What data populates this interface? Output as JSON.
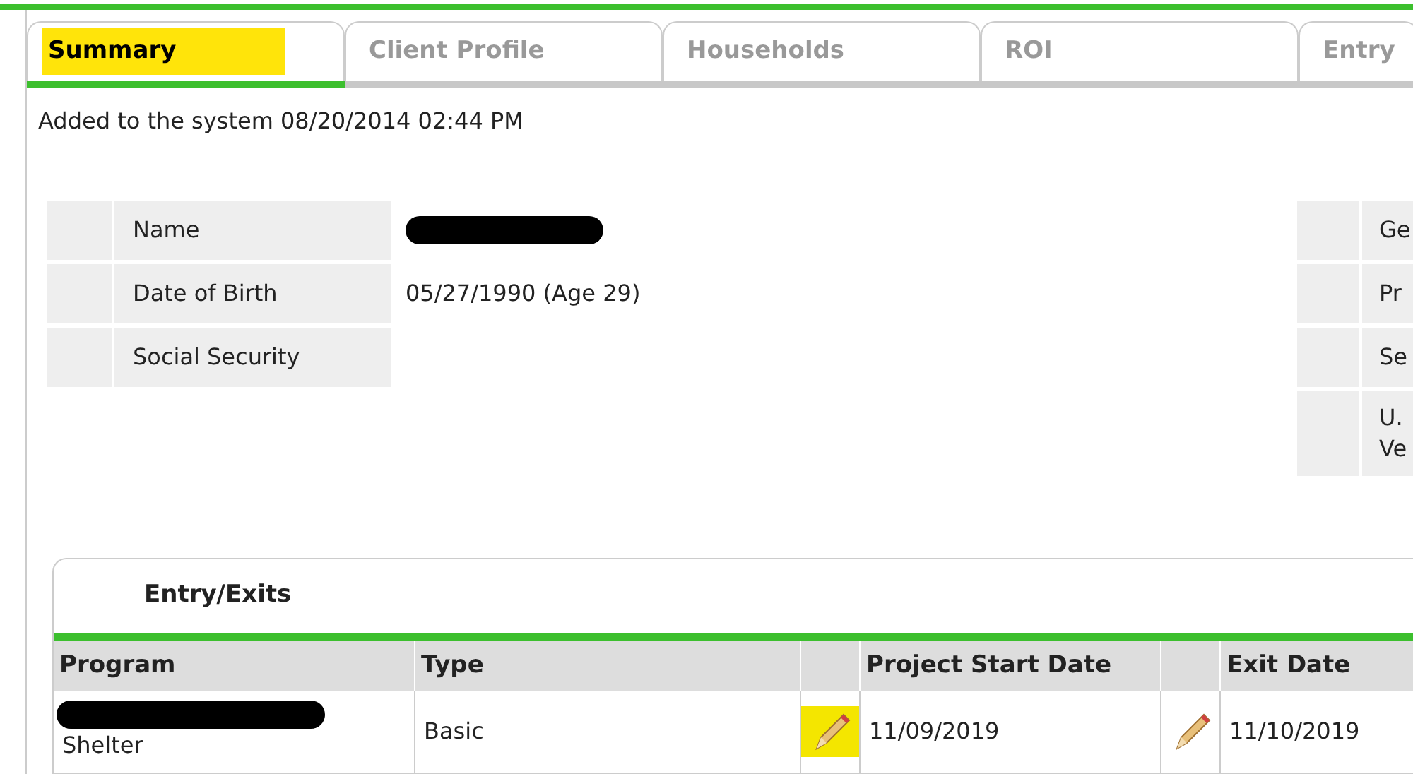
{
  "tabs": [
    {
      "label": "Summary",
      "selected": true
    },
    {
      "label": "Client Profile",
      "selected": false
    },
    {
      "label": "Households",
      "selected": false
    },
    {
      "label": "ROI",
      "selected": false
    },
    {
      "label": "Entry",
      "selected": false
    }
  ],
  "added_note": "Added to the system 08/20/2014 02:44 PM",
  "details_left": [
    {
      "label": "Name",
      "redacted": true
    },
    {
      "label": "Date of Birth",
      "value": "05/27/1990 (Age 29)",
      "redacted": false
    },
    {
      "label": "Social Security",
      "redacted": false
    }
  ],
  "details_right": [
    {
      "label": "Ge"
    },
    {
      "label": "Pr"
    },
    {
      "label": "Se"
    },
    {
      "label": "U.\nVe"
    }
  ],
  "entry_exits": {
    "title": "Entry/Exits",
    "columns": [
      "Program",
      "Type",
      "Project Start Date",
      "Exit Date"
    ],
    "rows": [
      {
        "program": "Shelter",
        "program_redacted": true,
        "type": "Basic",
        "start_date": "11/09/2019",
        "start_highlighted": true,
        "exit_date": "11/10/2019",
        "exit_highlighted": false
      }
    ]
  }
}
